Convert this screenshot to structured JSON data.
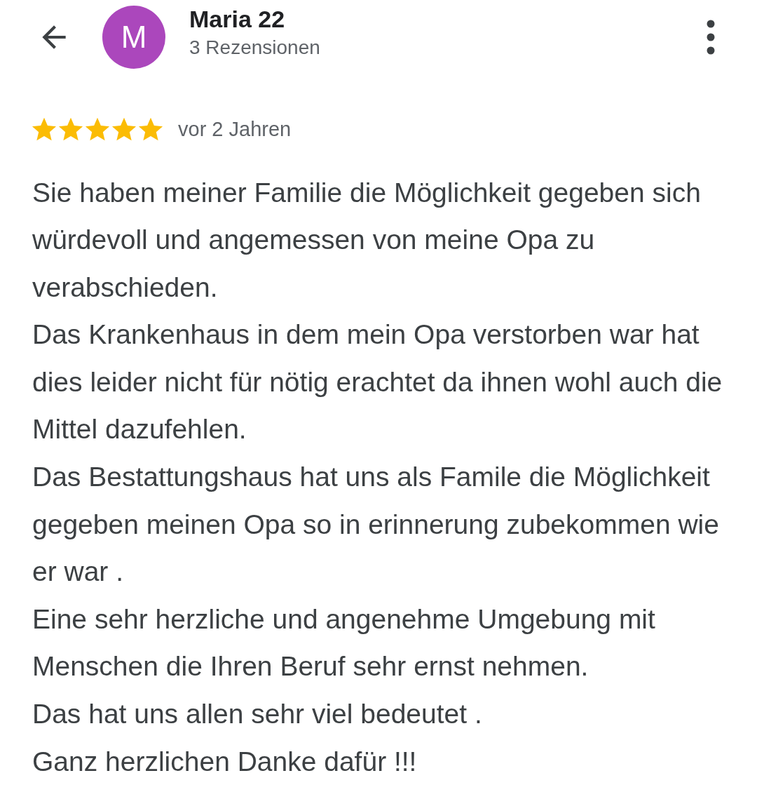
{
  "header": {
    "avatar_letter": "M",
    "name": "Maria 22",
    "review_count": "3 Rezensionen"
  },
  "review": {
    "stars": 5,
    "time": "vor 2 Jahren",
    "paragraphs": [
      "Sie haben meiner Familie die Möglichkeit gegeben sich würdevoll und angemessen von meine Opa zu verabschieden.",
      "Das Krankenhaus in dem mein Opa verstorben war hat dies leider nicht für nötig erachtet da ihnen wohl auch die Mittel dazufehlen.",
      "Das Bestattungshaus hat uns als Famile die Möglichkeit gegeben meinen Opa so in erinnerung zubekommen wie er war .",
      "Eine sehr herzliche und angenehme Umgebung mit Menschen die Ihren Beruf sehr ernst nehmen.",
      "Das hat uns allen sehr viel bedeutet .",
      "Ganz herzlichen Danke dafür !!!"
    ]
  }
}
